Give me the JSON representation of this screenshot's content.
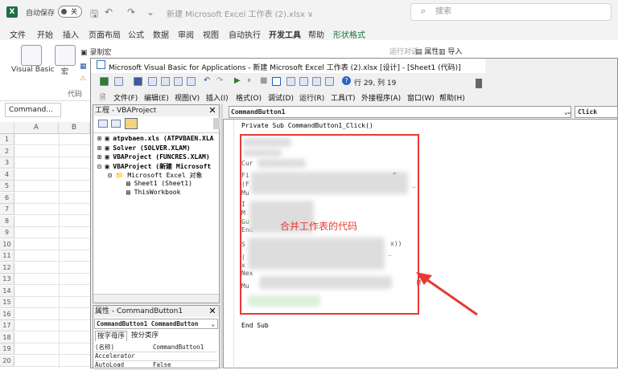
{
  "excel": {
    "logo": "X",
    "autosave_label": "自动保存",
    "autosave_state": "关",
    "doc_title": "新建 Microsoft Excel 工作表 (2).xlsx ∨",
    "search_placeholder": "搜索",
    "menu": [
      "文件",
      "开始",
      "插入",
      "页面布局",
      "公式",
      "数据",
      "审阅",
      "视图",
      "自动执行",
      "开发工具",
      "帮助",
      "形状格式"
    ],
    "active_menu": "开发工具",
    "ribbon": {
      "visual_basic": "Visual Basic",
      "macros": "宏",
      "record_macro": "录制宏",
      "group_code": "代码",
      "property": "属性",
      "run_dialog": "运行对话",
      "import": "导入"
    },
    "name_box": "Command...",
    "columns": [
      "A",
      "B"
    ],
    "rows": [
      "1",
      "2",
      "3",
      "4",
      "5",
      "6",
      "7",
      "8",
      "9",
      "10",
      "11",
      "12",
      "13",
      "14",
      "15",
      "16",
      "17",
      "18",
      "19",
      "20"
    ]
  },
  "vba": {
    "title": "Microsoft Visual Basic for Applications - 新建 Microsoft Excel 工作表 (2).xlsx [设计] - [Sheet1 (代码)]",
    "cursor_pos": "行 29, 列 19",
    "menu": [
      "文件(F)",
      "编辑(E)",
      "视图(V)",
      "插入(I)",
      "格式(O)",
      "调试(D)",
      "运行(R)",
      "工具(T)",
      "外接程序(A)",
      "窗口(W)",
      "帮助(H)"
    ],
    "project_title": "工程 - VBAProject",
    "tree": [
      {
        "label": "atpvbaen.xls (ATPVBAEN.XLA",
        "bold": true
      },
      {
        "label": "Solver (SOLVER.XLAM)",
        "bold": true
      },
      {
        "label": "VBAProject (FUNCRES.XLAM)",
        "bold": true
      },
      {
        "label": "VBAProject (新建 Microsoft",
        "bold": true
      },
      {
        "label": "Microsoft Excel 对象",
        "bold": false
      },
      {
        "label": "Sheet1 (Sheet1)",
        "bold": false
      },
      {
        "label": "ThisWorkbook",
        "bold": false
      }
    ],
    "props_title": "属性 - CommandButton1",
    "props_object": "CommandButton1 CommandButton",
    "props_tabs": [
      "按字母序",
      "按分类序"
    ],
    "props_rows": [
      {
        "name": "(名称)",
        "value": "CommandButton1"
      },
      {
        "name": "Accelerator",
        "value": ""
      },
      {
        "name": "AutoLoad",
        "value": "False"
      }
    ],
    "object_combo": "CommandButton1",
    "proc_combo": "Click",
    "code_first": "Private Sub CommandButton1_Click()",
    "code_last": "End Sub",
    "code_fragments": [
      "Cur",
      "Fi",
      "(F",
      "Mu",
      "I",
      "M",
      "Gu",
      "End",
      "S",
      "x))",
      "(",
      "Nex",
      "Mu",
      "\"",
      "_",
      "_",
      "x",
      "M"
    ],
    "annotation": "合并工作表的代码"
  },
  "colors": {
    "annotation": "#e53935",
    "excel_green": "#1d6f42"
  }
}
